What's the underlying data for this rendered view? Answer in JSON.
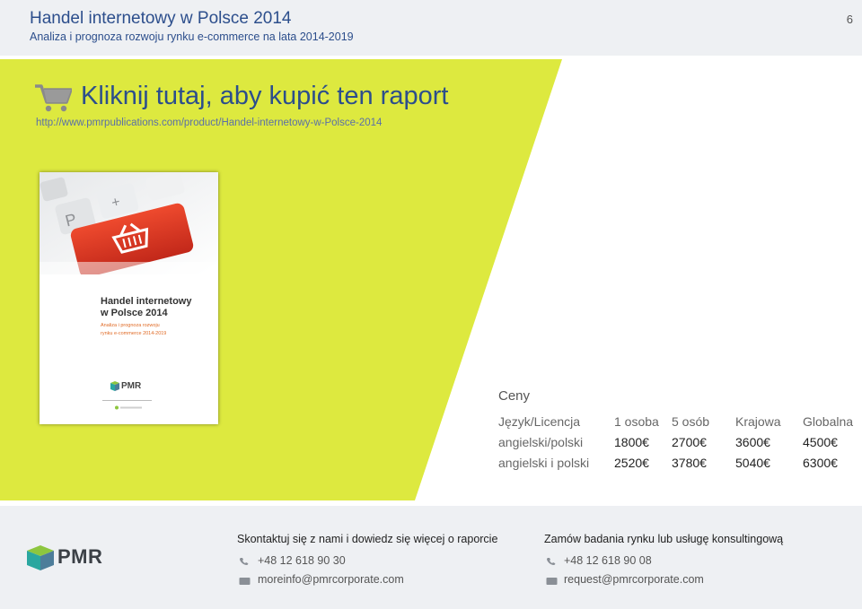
{
  "header": {
    "title": "Handel internetowy w Polsce 2014",
    "subtitle": "Analiza i prognoza rozwoju rynku e-commerce na lata 2014-2019",
    "page_number": "6"
  },
  "promo": {
    "cta": "Kliknij tutaj, aby kupić ten raport",
    "url": "http://www.pmrpublications.com/product/Handel-internetowy-w-Polsce-2014",
    "icon": "shopping-cart-icon"
  },
  "cover": {
    "title_line1": "Handel internetowy",
    "title_line2": "w Polsce 2014",
    "sub_line1": "Analiza i prognoza rozwoju",
    "sub_line2": "rynku e-commerce 2014-2019",
    "logo_text": "PMR"
  },
  "prices": {
    "heading": "Ceny",
    "columns": [
      "Język/Licencja",
      "1 osoba",
      "5 osób",
      "Krajowa",
      "Globalna"
    ],
    "rows": [
      [
        "angielski/polski",
        "1800€",
        "2700€",
        "3600€",
        "4500€"
      ],
      [
        "angielski i polski",
        "2520€",
        "3780€",
        "5040€",
        "6300€"
      ]
    ]
  },
  "footer": {
    "logo_text": "PMR",
    "left": {
      "title": "Skontaktuj się z nami i dowiedz się więcej  o raporcie",
      "phone": "+48 12 618 90 30",
      "email": "moreinfo@pmrcorporate.com"
    },
    "right": {
      "title": "Zamów badania rynku lub  usługę konsultingową",
      "phone": "+48 12 618 90 08",
      "email": "request@pmrcorporate.com"
    }
  },
  "colors": {
    "accent_green": "#dde93f",
    "title_blue": "#2c4e8c",
    "cover_red": "#d9341f"
  }
}
